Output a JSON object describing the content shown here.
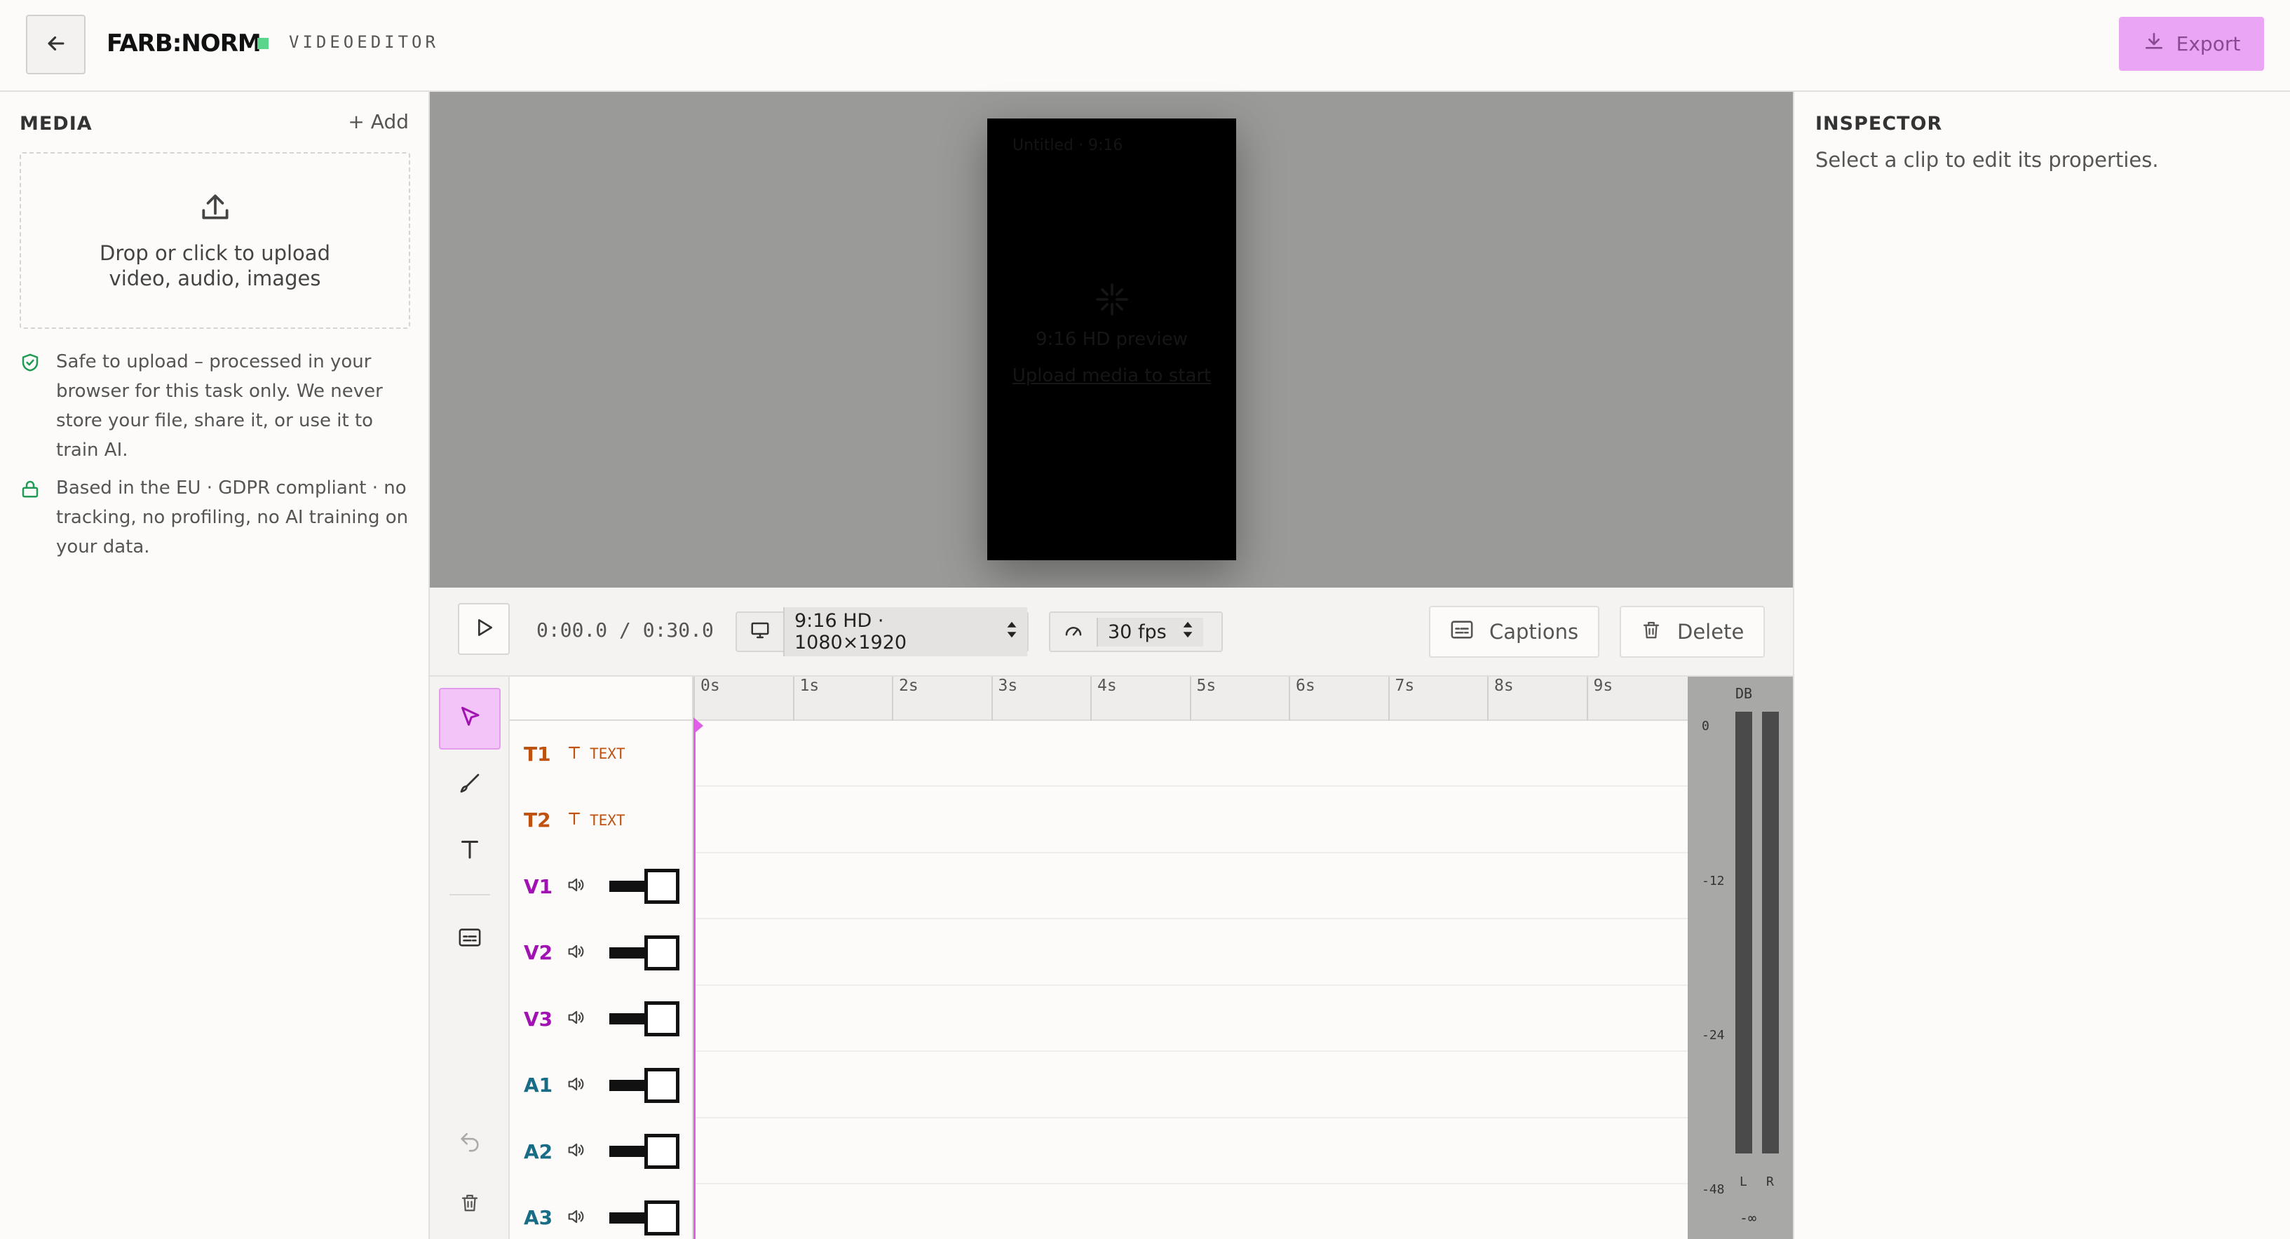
{
  "header": {
    "back_icon": "arrow-left-icon",
    "brand": "FARB:NORM",
    "subtitle": "VIDEOEDITOR",
    "export_label": "Export",
    "export_icon": "download-icon",
    "accent": "#eaa6f4"
  },
  "media": {
    "title": "MEDIA",
    "add_label": "+ Add",
    "dropzone_icon": "upload-icon",
    "dropzone_text": "Drop or click to upload video, audio, images",
    "notes": [
      {
        "icon": "shield-check-icon",
        "text": "Safe to upload – processed in your browser for this task only. We never store your file, share it, or use it to train AI."
      },
      {
        "icon": "lock-icon",
        "text": "Based in the EU · GDPR compliant · no tracking, no profiling, no AI training on your data."
      }
    ]
  },
  "preview": {
    "top_hint": "Untitled · 9:16",
    "line1": "9:16 HD preview",
    "line2": "Upload media to start"
  },
  "transport": {
    "timecode": "0:00.0 / 0:30.0",
    "resolution": "9:16 HD · 1080×1920",
    "fps": "30 fps",
    "captions_label": "Captions",
    "delete_label": "Delete"
  },
  "timeline": {
    "tools": [
      "select-tool-icon",
      "brush-tool-icon",
      "text-tool-icon",
      "captions-tool-icon",
      "undo-icon",
      "trash-icon"
    ],
    "ticks": [
      "0s",
      "1s",
      "2s",
      "3s",
      "4s",
      "5s",
      "6s",
      "7s",
      "8s",
      "9s"
    ],
    "tracks": [
      {
        "name": "T1",
        "kind": "text",
        "tag": "TEXT"
      },
      {
        "name": "T2",
        "kind": "text",
        "tag": "TEXT"
      },
      {
        "name": "V1",
        "kind": "video"
      },
      {
        "name": "V2",
        "kind": "video"
      },
      {
        "name": "V3",
        "kind": "video"
      },
      {
        "name": "A1",
        "kind": "audio"
      },
      {
        "name": "A2",
        "kind": "audio"
      },
      {
        "name": "A3",
        "kind": "audio"
      }
    ],
    "playhead_color": "#e05ee8"
  },
  "meter": {
    "title": "DB",
    "levels": [
      "0",
      "-12",
      "-24",
      "-48"
    ],
    "left_label": "L",
    "right_label": "R",
    "floor": "-∞"
  },
  "inspector": {
    "title": "INSPECTOR",
    "hint": "Select a clip to edit its properties."
  }
}
